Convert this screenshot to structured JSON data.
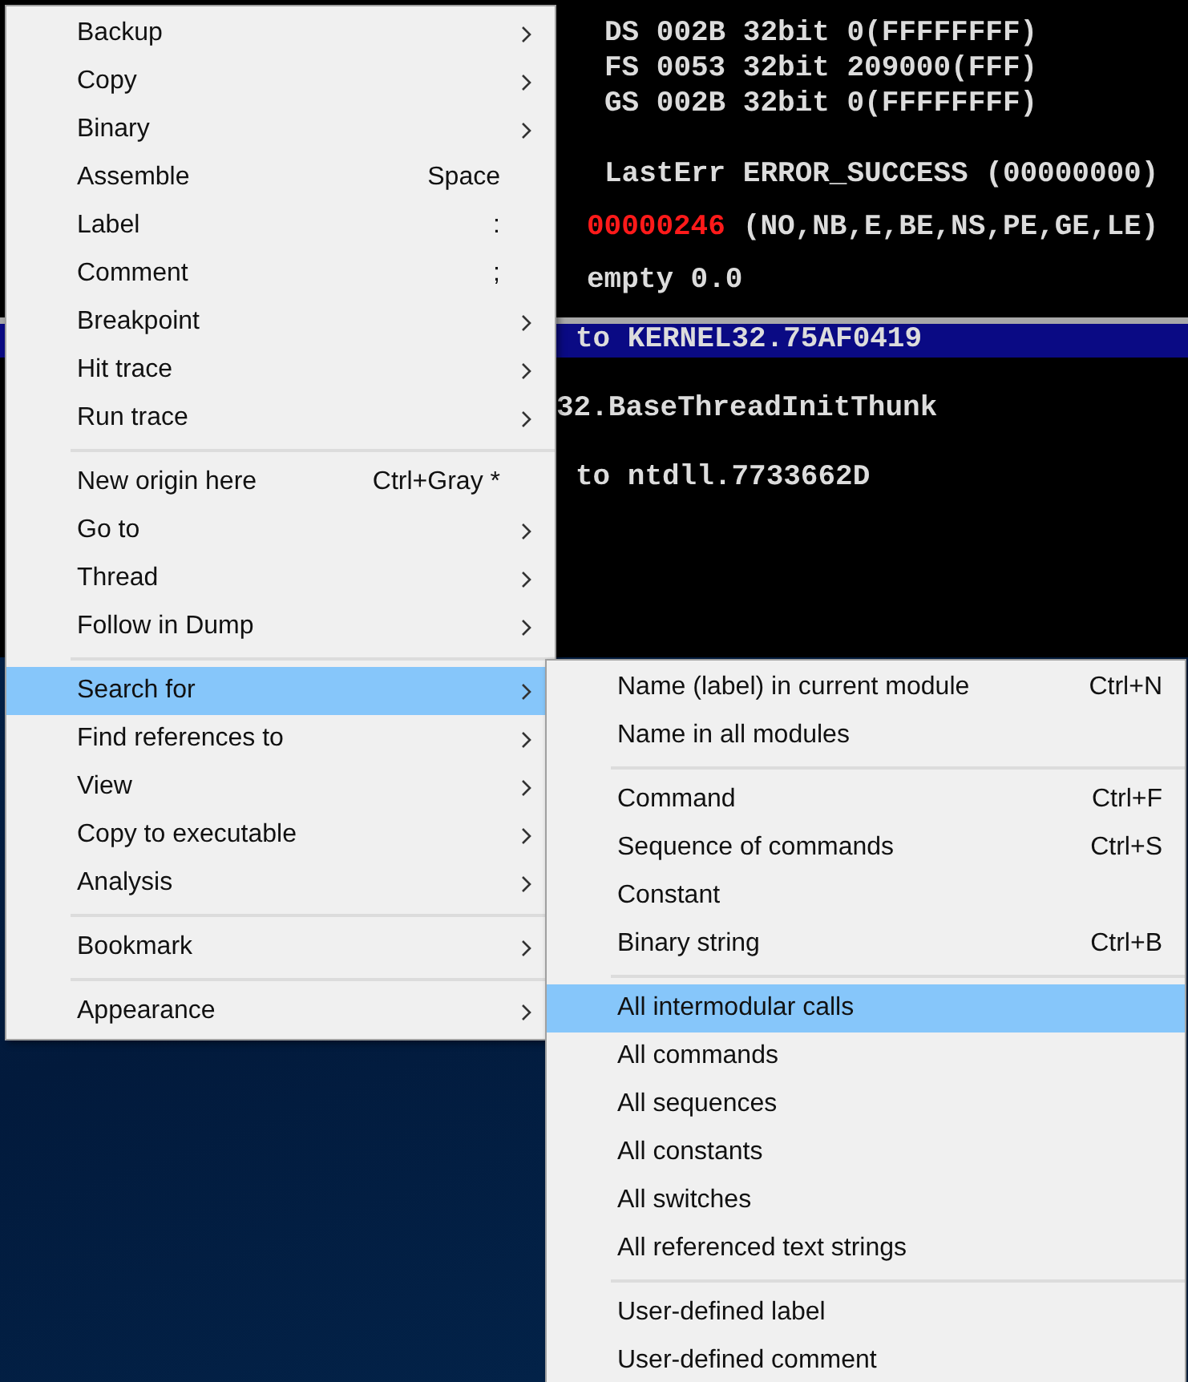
{
  "registers": {
    "rows": [
      {
        "kind": "segment",
        "cells": [
          {
            "text": "DS 002B 32bit 0(FFFFFFFF)",
            "changed": false
          }
        ]
      },
      {
        "kind": "segment",
        "cells": [
          {
            "text": "FS 0053 32bit 209000(FFF)",
            "changed": false
          }
        ]
      },
      {
        "kind": "segment",
        "cells": [
          {
            "text": "GS 002B 32bit 0(FFFFFFFF)",
            "changed": false
          }
        ]
      },
      {
        "kind": "blank",
        "cells": []
      },
      {
        "kind": "segment",
        "cells": [
          {
            "text": "LastErr ERROR_SUCCESS (00000000)",
            "changed": false
          }
        ]
      },
      {
        "kind": "flags",
        "cells": [
          {
            "text": "00000246",
            "changed": true
          },
          {
            "text": "(NO,NB,E,BE,NS,PE,GE,LE)",
            "changed": false
          }
        ]
      },
      {
        "kind": "fpu",
        "cells": [
          {
            "text": "empty 0.0",
            "changed": false
          }
        ]
      }
    ]
  },
  "stack": {
    "rows": [
      {
        "kind": "call",
        "text": "to KERNEL32.75AF0419",
        "selected": true
      },
      {
        "kind": "name",
        "text": "32.BaseThreadInitThunk",
        "selected": false
      },
      {
        "kind": "call",
        "text": "to ntdll.7733662D",
        "selected": false
      }
    ]
  },
  "context_menu": {
    "groups": [
      [
        {
          "label": "Backup",
          "submenu": true,
          "selected": false
        },
        {
          "label": "Copy",
          "submenu": true,
          "selected": false
        },
        {
          "label": "Binary",
          "submenu": true,
          "selected": false
        },
        {
          "label": "Assemble",
          "shortcut": "Space",
          "submenu": false,
          "selected": false
        },
        {
          "label": "Label",
          "shortcut": ":",
          "submenu": false,
          "selected": false
        },
        {
          "label": "Comment",
          "shortcut": ";",
          "submenu": false,
          "selected": false
        },
        {
          "label": "Breakpoint",
          "submenu": true,
          "selected": false
        },
        {
          "label": "Hit trace",
          "submenu": true,
          "selected": false
        },
        {
          "label": "Run trace",
          "submenu": true,
          "selected": false
        }
      ],
      [
        {
          "label": "New origin here",
          "shortcut": "Ctrl+Gray *",
          "submenu": false,
          "selected": false
        },
        {
          "label": "Go to",
          "submenu": true,
          "selected": false
        },
        {
          "label": "Thread",
          "submenu": true,
          "selected": false
        },
        {
          "label": "Follow in Dump",
          "submenu": true,
          "selected": false
        }
      ],
      [
        {
          "label": "Search for",
          "submenu": true,
          "selected": true
        },
        {
          "label": "Find references to",
          "submenu": true,
          "selected": false
        },
        {
          "label": "View",
          "submenu": true,
          "selected": false
        },
        {
          "label": "Copy to executable",
          "submenu": true,
          "selected": false
        },
        {
          "label": "Analysis",
          "submenu": true,
          "selected": false
        }
      ],
      [
        {
          "label": "Bookmark",
          "submenu": true,
          "selected": false
        }
      ],
      [
        {
          "label": "Appearance",
          "submenu": true,
          "selected": false
        }
      ]
    ]
  },
  "submenu": {
    "groups": [
      [
        {
          "label": "Name (label) in current module",
          "shortcut": "Ctrl+N",
          "selected": false
        },
        {
          "label": "Name in all modules",
          "selected": false
        }
      ],
      [
        {
          "label": "Command",
          "shortcut": "Ctrl+F",
          "selected": false
        },
        {
          "label": "Sequence of commands",
          "shortcut": "Ctrl+S",
          "selected": false
        },
        {
          "label": "Constant",
          "selected": false
        },
        {
          "label": "Binary string",
          "shortcut": "Ctrl+B",
          "selected": false
        }
      ],
      [
        {
          "label": "All intermodular calls",
          "selected": true
        },
        {
          "label": "All commands",
          "selected": false
        },
        {
          "label": "All sequences",
          "selected": false
        },
        {
          "label": "All constants",
          "selected": false
        },
        {
          "label": "All switches",
          "selected": false
        },
        {
          "label": "All referenced text strings",
          "selected": false
        }
      ],
      [
        {
          "label": "User-defined label",
          "selected": false
        },
        {
          "label": "User-defined comment",
          "selected": false
        }
      ]
    ]
  }
}
